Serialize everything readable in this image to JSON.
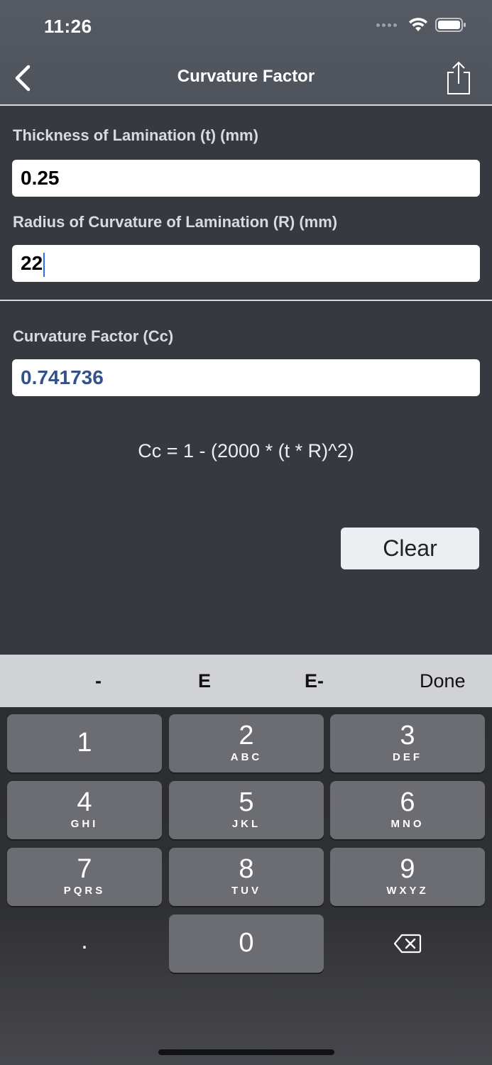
{
  "status": {
    "time": "11:26"
  },
  "nav": {
    "title": "Curvature Factor",
    "back_icon": "chevron-left-icon",
    "share_icon": "share-icon"
  },
  "form": {
    "thickness": {
      "label": "Thickness of Lamination (t) (mm)",
      "value": "0.25"
    },
    "radius": {
      "label": "Radius of Curvature of Lamination (R) (mm)",
      "value": "22"
    },
    "result": {
      "label": "Curvature Factor (Cc)",
      "value": "0.741736"
    }
  },
  "formula": "Cc = 1 - (2000 * (t * R)^2)",
  "clear_label": "Clear",
  "accessory": {
    "minus": "-",
    "e": "E",
    "e_minus": "E-",
    "done": "Done"
  },
  "keypad": {
    "keys": [
      {
        "num": "1",
        "letters": ""
      },
      {
        "num": "2",
        "letters": "ABC"
      },
      {
        "num": "3",
        "letters": "DEF"
      },
      {
        "num": "4",
        "letters": "GHI"
      },
      {
        "num": "5",
        "letters": "JKL"
      },
      {
        "num": "6",
        "letters": "MNO"
      },
      {
        "num": "7",
        "letters": "PQRS"
      },
      {
        "num": "8",
        "letters": "TUV"
      },
      {
        "num": "9",
        "letters": "WXYZ"
      }
    ],
    "dot": ".",
    "zero": "0",
    "delete_icon": "backspace-icon"
  },
  "colors": {
    "background": "#363940",
    "result_text": "#33518a",
    "key": "#6c6d72"
  }
}
